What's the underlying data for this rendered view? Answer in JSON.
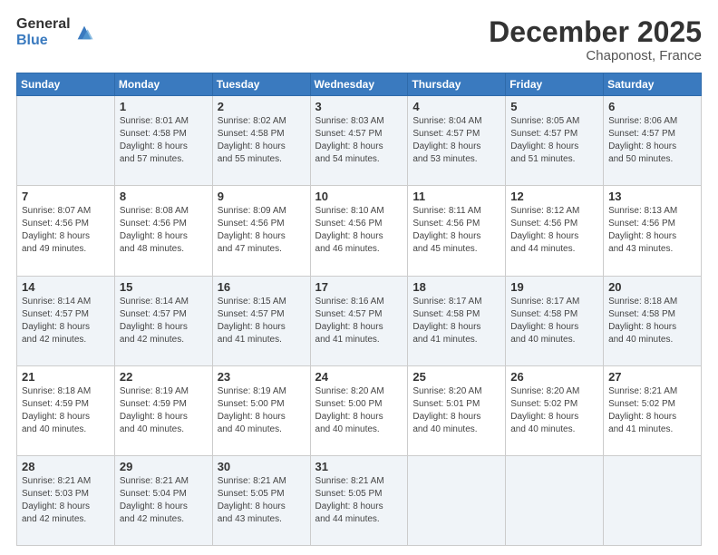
{
  "logo": {
    "general": "General",
    "blue": "Blue"
  },
  "header": {
    "month": "December 2025",
    "location": "Chaponost, France"
  },
  "weekdays": [
    "Sunday",
    "Monday",
    "Tuesday",
    "Wednesday",
    "Thursday",
    "Friday",
    "Saturday"
  ],
  "weeks": [
    [
      {
        "day": "",
        "sunrise": "",
        "sunset": "",
        "daylight": ""
      },
      {
        "day": "1",
        "sunrise": "Sunrise: 8:01 AM",
        "sunset": "Sunset: 4:58 PM",
        "daylight": "Daylight: 8 hours and 57 minutes."
      },
      {
        "day": "2",
        "sunrise": "Sunrise: 8:02 AM",
        "sunset": "Sunset: 4:58 PM",
        "daylight": "Daylight: 8 hours and 55 minutes."
      },
      {
        "day": "3",
        "sunrise": "Sunrise: 8:03 AM",
        "sunset": "Sunset: 4:57 PM",
        "daylight": "Daylight: 8 hours and 54 minutes."
      },
      {
        "day": "4",
        "sunrise": "Sunrise: 8:04 AM",
        "sunset": "Sunset: 4:57 PM",
        "daylight": "Daylight: 8 hours and 53 minutes."
      },
      {
        "day": "5",
        "sunrise": "Sunrise: 8:05 AM",
        "sunset": "Sunset: 4:57 PM",
        "daylight": "Daylight: 8 hours and 51 minutes."
      },
      {
        "day": "6",
        "sunrise": "Sunrise: 8:06 AM",
        "sunset": "Sunset: 4:57 PM",
        "daylight": "Daylight: 8 hours and 50 minutes."
      }
    ],
    [
      {
        "day": "7",
        "sunrise": "Sunrise: 8:07 AM",
        "sunset": "Sunset: 4:56 PM",
        "daylight": "Daylight: 8 hours and 49 minutes."
      },
      {
        "day": "8",
        "sunrise": "Sunrise: 8:08 AM",
        "sunset": "Sunset: 4:56 PM",
        "daylight": "Daylight: 8 hours and 48 minutes."
      },
      {
        "day": "9",
        "sunrise": "Sunrise: 8:09 AM",
        "sunset": "Sunset: 4:56 PM",
        "daylight": "Daylight: 8 hours and 47 minutes."
      },
      {
        "day": "10",
        "sunrise": "Sunrise: 8:10 AM",
        "sunset": "Sunset: 4:56 PM",
        "daylight": "Daylight: 8 hours and 46 minutes."
      },
      {
        "day": "11",
        "sunrise": "Sunrise: 8:11 AM",
        "sunset": "Sunset: 4:56 PM",
        "daylight": "Daylight: 8 hours and 45 minutes."
      },
      {
        "day": "12",
        "sunrise": "Sunrise: 8:12 AM",
        "sunset": "Sunset: 4:56 PM",
        "daylight": "Daylight: 8 hours and 44 minutes."
      },
      {
        "day": "13",
        "sunrise": "Sunrise: 8:13 AM",
        "sunset": "Sunset: 4:56 PM",
        "daylight": "Daylight: 8 hours and 43 minutes."
      }
    ],
    [
      {
        "day": "14",
        "sunrise": "Sunrise: 8:14 AM",
        "sunset": "Sunset: 4:57 PM",
        "daylight": "Daylight: 8 hours and 42 minutes."
      },
      {
        "day": "15",
        "sunrise": "Sunrise: 8:14 AM",
        "sunset": "Sunset: 4:57 PM",
        "daylight": "Daylight: 8 hours and 42 minutes."
      },
      {
        "day": "16",
        "sunrise": "Sunrise: 8:15 AM",
        "sunset": "Sunset: 4:57 PM",
        "daylight": "Daylight: 8 hours and 41 minutes."
      },
      {
        "day": "17",
        "sunrise": "Sunrise: 8:16 AM",
        "sunset": "Sunset: 4:57 PM",
        "daylight": "Daylight: 8 hours and 41 minutes."
      },
      {
        "day": "18",
        "sunrise": "Sunrise: 8:17 AM",
        "sunset": "Sunset: 4:58 PM",
        "daylight": "Daylight: 8 hours and 41 minutes."
      },
      {
        "day": "19",
        "sunrise": "Sunrise: 8:17 AM",
        "sunset": "Sunset: 4:58 PM",
        "daylight": "Daylight: 8 hours and 40 minutes."
      },
      {
        "day": "20",
        "sunrise": "Sunrise: 8:18 AM",
        "sunset": "Sunset: 4:58 PM",
        "daylight": "Daylight: 8 hours and 40 minutes."
      }
    ],
    [
      {
        "day": "21",
        "sunrise": "Sunrise: 8:18 AM",
        "sunset": "Sunset: 4:59 PM",
        "daylight": "Daylight: 8 hours and 40 minutes."
      },
      {
        "day": "22",
        "sunrise": "Sunrise: 8:19 AM",
        "sunset": "Sunset: 4:59 PM",
        "daylight": "Daylight: 8 hours and 40 minutes."
      },
      {
        "day": "23",
        "sunrise": "Sunrise: 8:19 AM",
        "sunset": "Sunset: 5:00 PM",
        "daylight": "Daylight: 8 hours and 40 minutes."
      },
      {
        "day": "24",
        "sunrise": "Sunrise: 8:20 AM",
        "sunset": "Sunset: 5:00 PM",
        "daylight": "Daylight: 8 hours and 40 minutes."
      },
      {
        "day": "25",
        "sunrise": "Sunrise: 8:20 AM",
        "sunset": "Sunset: 5:01 PM",
        "daylight": "Daylight: 8 hours and 40 minutes."
      },
      {
        "day": "26",
        "sunrise": "Sunrise: 8:20 AM",
        "sunset": "Sunset: 5:02 PM",
        "daylight": "Daylight: 8 hours and 40 minutes."
      },
      {
        "day": "27",
        "sunrise": "Sunrise: 8:21 AM",
        "sunset": "Sunset: 5:02 PM",
        "daylight": "Daylight: 8 hours and 41 minutes."
      }
    ],
    [
      {
        "day": "28",
        "sunrise": "Sunrise: 8:21 AM",
        "sunset": "Sunset: 5:03 PM",
        "daylight": "Daylight: 8 hours and 42 minutes."
      },
      {
        "day": "29",
        "sunrise": "Sunrise: 8:21 AM",
        "sunset": "Sunset: 5:04 PM",
        "daylight": "Daylight: 8 hours and 42 minutes."
      },
      {
        "day": "30",
        "sunrise": "Sunrise: 8:21 AM",
        "sunset": "Sunset: 5:05 PM",
        "daylight": "Daylight: 8 hours and 43 minutes."
      },
      {
        "day": "31",
        "sunrise": "Sunrise: 8:21 AM",
        "sunset": "Sunset: 5:05 PM",
        "daylight": "Daylight: 8 hours and 44 minutes."
      },
      {
        "day": "",
        "sunrise": "",
        "sunset": "",
        "daylight": ""
      },
      {
        "day": "",
        "sunrise": "",
        "sunset": "",
        "daylight": ""
      },
      {
        "day": "",
        "sunrise": "",
        "sunset": "",
        "daylight": ""
      }
    ]
  ]
}
